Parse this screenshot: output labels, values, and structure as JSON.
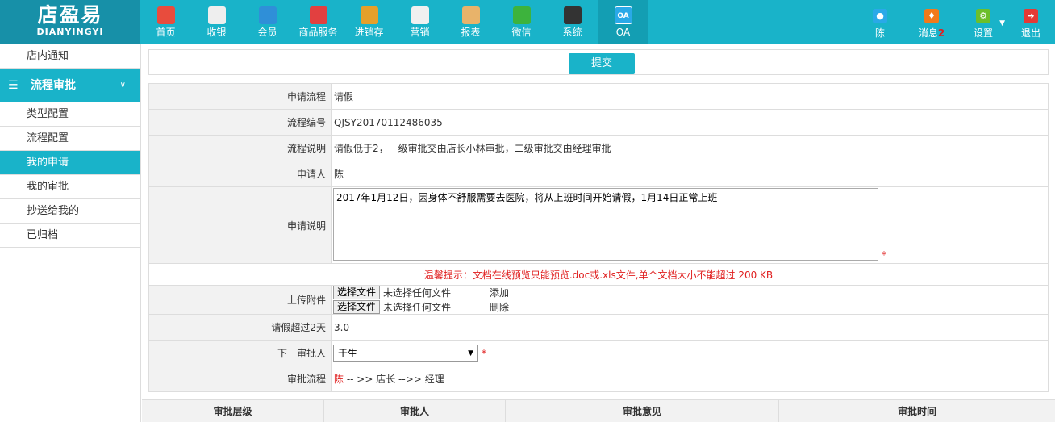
{
  "logo": {
    "cn": "店盈易",
    "en": "DIANYINGYI"
  },
  "nav": [
    {
      "label": "首页",
      "icon": "home-icon",
      "color": "#e84c3d"
    },
    {
      "label": "收银",
      "icon": "cash-register-icon",
      "color": "#eeeeee"
    },
    {
      "label": "会员",
      "icon": "member-icon",
      "color": "#2f8fd8"
    },
    {
      "label": "商品服务",
      "icon": "goods-icon",
      "color": "#e24040"
    },
    {
      "label": "进销存",
      "icon": "inventory-icon",
      "color": "#e5a02a"
    },
    {
      "label": "营销",
      "icon": "marketing-icon",
      "color": "#f0f0f0"
    },
    {
      "label": "报表",
      "icon": "report-icon",
      "color": "#e8b36a"
    },
    {
      "label": "微信",
      "icon": "wechat-icon",
      "color": "#3db33d"
    },
    {
      "label": "系统",
      "icon": "system-icon",
      "color": "#333333"
    },
    {
      "label": "OA",
      "icon": "oa-icon",
      "color": "#2aa9e8"
    }
  ],
  "right_nav": {
    "user": {
      "label": "陈",
      "icon": "user-icon",
      "color": "#2aa9e8"
    },
    "messages": {
      "label": "消息",
      "count": "2",
      "icon": "bell-icon",
      "color": "#f27a1a"
    },
    "settings": {
      "label": "设置",
      "icon": "gear-icon",
      "color": "#6cbf2a"
    },
    "logout": {
      "label": "退出",
      "icon": "logout-icon",
      "color": "#e53935"
    }
  },
  "sidebar": {
    "top_item": "店内通知",
    "group": "流程审批",
    "items": [
      "类型配置",
      "流程配置",
      "我的申请",
      "我的审批",
      "抄送给我的",
      "已归档"
    ],
    "active": "我的申请"
  },
  "form": {
    "submit_label": "提交",
    "process_label": "申请流程",
    "process_value": "请假",
    "code_label": "流程编号",
    "code_value": "QJSY20170112486035",
    "desc_label": "流程说明",
    "desc_value": "请假低于2，一级审批交由店长小林审批，二级审批交由经理审批",
    "applicant_label": "申请人",
    "applicant_value": "陈",
    "reason_label": "申请说明",
    "reason_value": "2017年1月12日，因身体不舒服需要去医院，将从上班时间开始请假，1月14日正常上班",
    "required_mark": "*",
    "tip": "温馨提示：文档在线预览只能预览.doc或.xls文件,单个文档大小不能超过 200 KB",
    "attach_label": "上传附件",
    "file_button": "选择文件",
    "file_none": "未选择任何文件",
    "add_label": "添加",
    "delete_label": "删除",
    "over_label": "请假超过2天",
    "over_value": "3.0",
    "next_label": "下一审批人",
    "next_value": "于生",
    "flow_label": "审批流程",
    "flow_start": "陈",
    "flow_rest": " -- >> 店长 -->> 经理"
  },
  "table": {
    "columns": [
      "审批层级",
      "审批人",
      "审批意见",
      "审批时间"
    ]
  }
}
